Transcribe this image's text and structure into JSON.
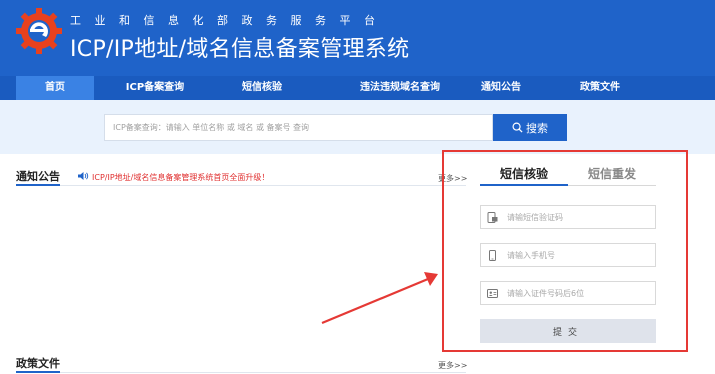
{
  "header": {
    "org_name": "工业和信息化部政务服务平台",
    "site_title": "ICP/IP地址/域名信息备案管理系统",
    "brand_color": "#1f63c9"
  },
  "nav": {
    "items": [
      {
        "label": "首页",
        "active": true
      },
      {
        "label": "ICP备案查询",
        "active": false
      },
      {
        "label": "短信核验",
        "active": false
      },
      {
        "label": "违法违规域名查询",
        "active": false
      },
      {
        "label": "通知公告",
        "active": false
      },
      {
        "label": "政策文件",
        "active": false
      }
    ]
  },
  "search": {
    "placeholder": "ICP备案查询：请输入 单位名称 或 域名 或 备案号 查询",
    "button_label": "搜索"
  },
  "notice": {
    "title": "通知公告",
    "headline": "ICP/IP地址/域名信息备案管理系统首页全面升级！",
    "more_label": "更多>>"
  },
  "policy": {
    "title": "政策文件",
    "more_label": "更多>>"
  },
  "sms_panel": {
    "tabs": [
      "短信核验",
      "短信重发"
    ],
    "active_tab": "短信核验",
    "fields": [
      {
        "icon": "sms-code-icon",
        "placeholder": "请输短信验证码"
      },
      {
        "icon": "mobile-phone-icon",
        "placeholder": "请输入手机号"
      },
      {
        "icon": "id-card-icon",
        "placeholder": "请输入证件号码后6位"
      }
    ],
    "submit_label": "提交"
  },
  "annotation": {
    "highlight_color": "#e53935"
  }
}
